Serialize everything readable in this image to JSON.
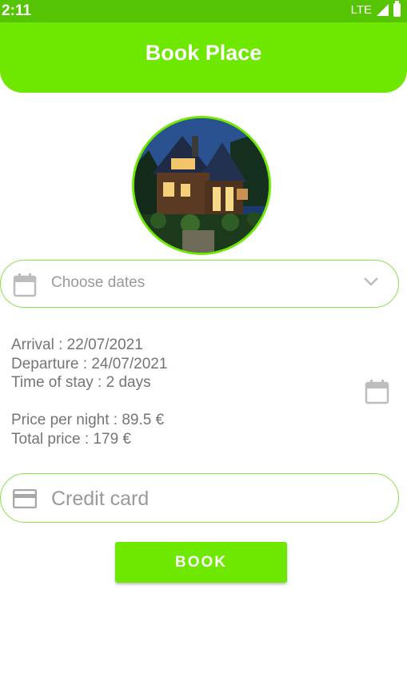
{
  "status_bar": {
    "time": "2:11",
    "network": "LTE"
  },
  "header": {
    "title": "Book Place"
  },
  "dates_field": {
    "placeholder": "Choose dates"
  },
  "stay": {
    "arrival": "Arrival : 22/07/2021",
    "departure": "Departure : 24/07/2021",
    "time_of_stay": "Time of stay : 2 days"
  },
  "pricing": {
    "price_per_night": "Price per night : 89.5 €",
    "total_price": "Total price : 179 €"
  },
  "card_field": {
    "placeholder": "Credit card"
  },
  "actions": {
    "book_label": "BOOK"
  },
  "colors": {
    "accent": "#6ee800",
    "status_bar": "#55c403",
    "border": "#8be04a",
    "text": "#757575",
    "placeholder": "#9a9a9a"
  }
}
